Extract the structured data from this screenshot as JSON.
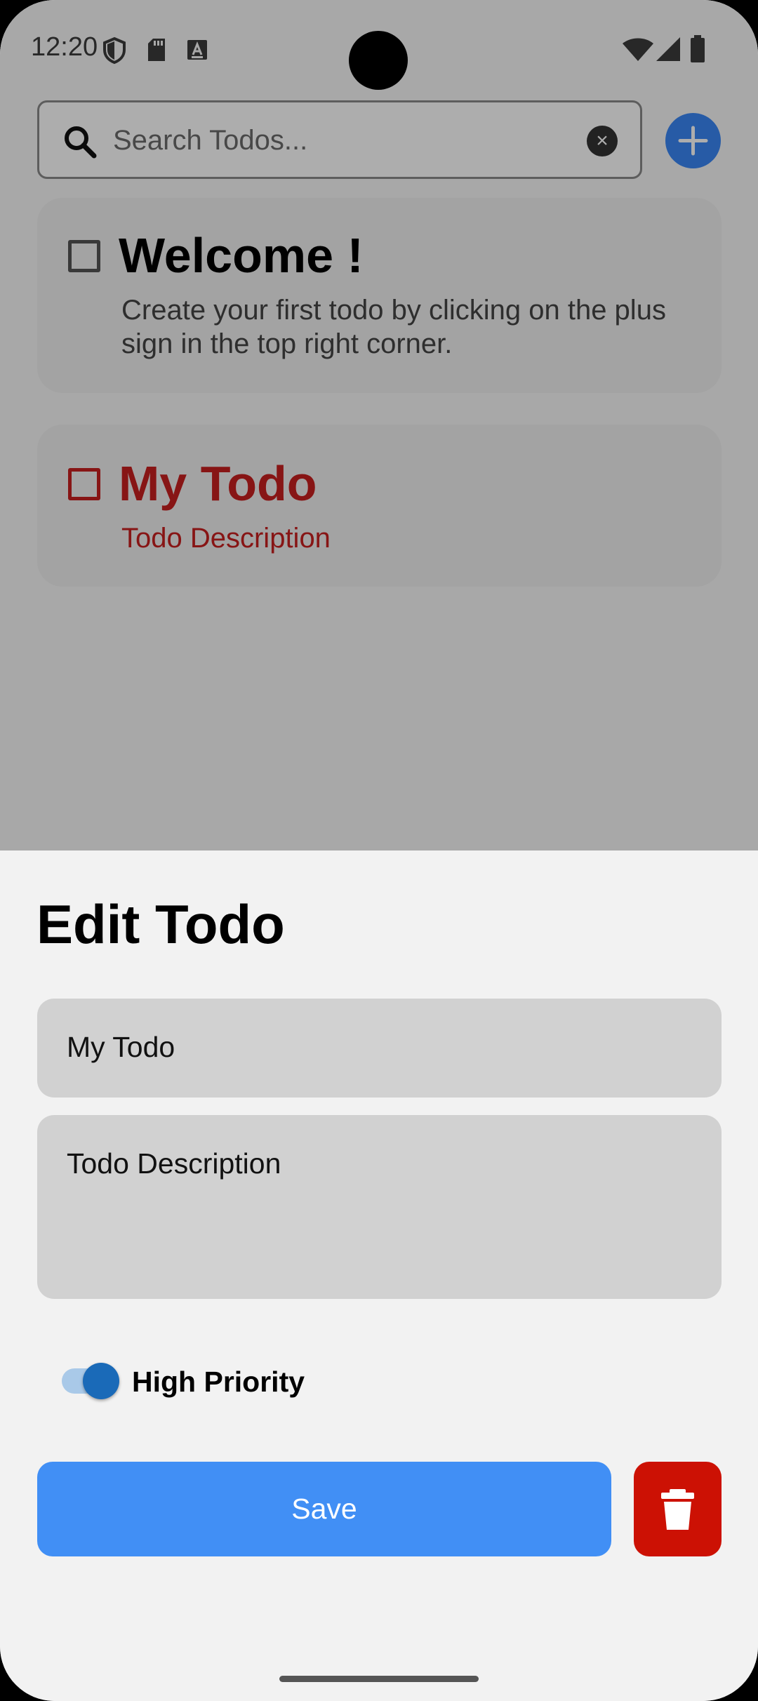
{
  "status_bar": {
    "time": "12:20"
  },
  "search": {
    "placeholder": "Search Todos...",
    "value": ""
  },
  "todos": [
    {
      "title": "Welcome !",
      "description": "Create your first todo by clicking on the plus sign in the top right corner.",
      "checked": false,
      "high_priority": false,
      "color": "#000000"
    },
    {
      "title": "My Todo",
      "description": "Todo Description",
      "checked": false,
      "high_priority": true,
      "color": "#c82020"
    }
  ],
  "edit_sheet": {
    "title": "Edit Todo",
    "title_field_value": "My Todo",
    "description_field_value": "Todo Description",
    "priority_label": "High Priority",
    "priority_on": true,
    "save_label": "Save"
  },
  "colors": {
    "accent": "#418ff5",
    "add_button": "#3a87f5",
    "delete": "#cc1104",
    "high_priority": "#c82020",
    "toggle_thumb": "#1a6ab8"
  },
  "icons": {
    "status": [
      "shield-icon",
      "sd-card-icon",
      "keyboard-a-icon",
      "wifi-icon",
      "signal-icon",
      "battery-icon"
    ],
    "search": "search-icon",
    "clear": "clear-icon",
    "add": "plus-icon",
    "delete": "trash-icon"
  }
}
